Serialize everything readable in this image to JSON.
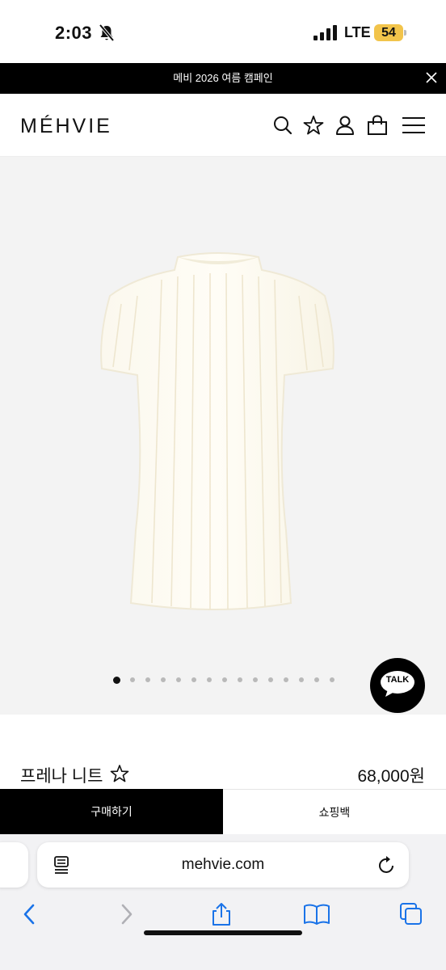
{
  "status_bar": {
    "time": "2:03",
    "network": "LTE",
    "battery": "54",
    "icons": [
      "bell-muted-icon",
      "signal-bars-icon",
      "battery-icon"
    ]
  },
  "announcement": {
    "text": "메비 2026 여름 캠페인",
    "close_icon": "close-icon"
  },
  "header": {
    "logo": "MÉHVIE",
    "icons": [
      "search-icon",
      "star-icon",
      "user-icon",
      "shopping-bag-icon",
      "menu-icon"
    ]
  },
  "gallery": {
    "image": "white-pleated-short-sleeve-knit-top",
    "total_slides": 15,
    "active_slide": 1,
    "talk_label": "TALK"
  },
  "product": {
    "name": "프레나 니트",
    "price": "68,000원",
    "wishlist_icon": "star-outline-icon"
  },
  "actions": {
    "buy_label": "구매하기",
    "cart_label": "쇼핑백"
  },
  "browser": {
    "url": "mehvie.com",
    "toolbar_icons": [
      "back-icon",
      "forward-icon",
      "share-icon",
      "bookmarks-icon",
      "tabs-icon"
    ]
  },
  "colors": {
    "accent": "#000000",
    "hero_bg": "#f3f3f3",
    "battery": "#f2c44b",
    "browser_blue": "#1a73e8"
  }
}
